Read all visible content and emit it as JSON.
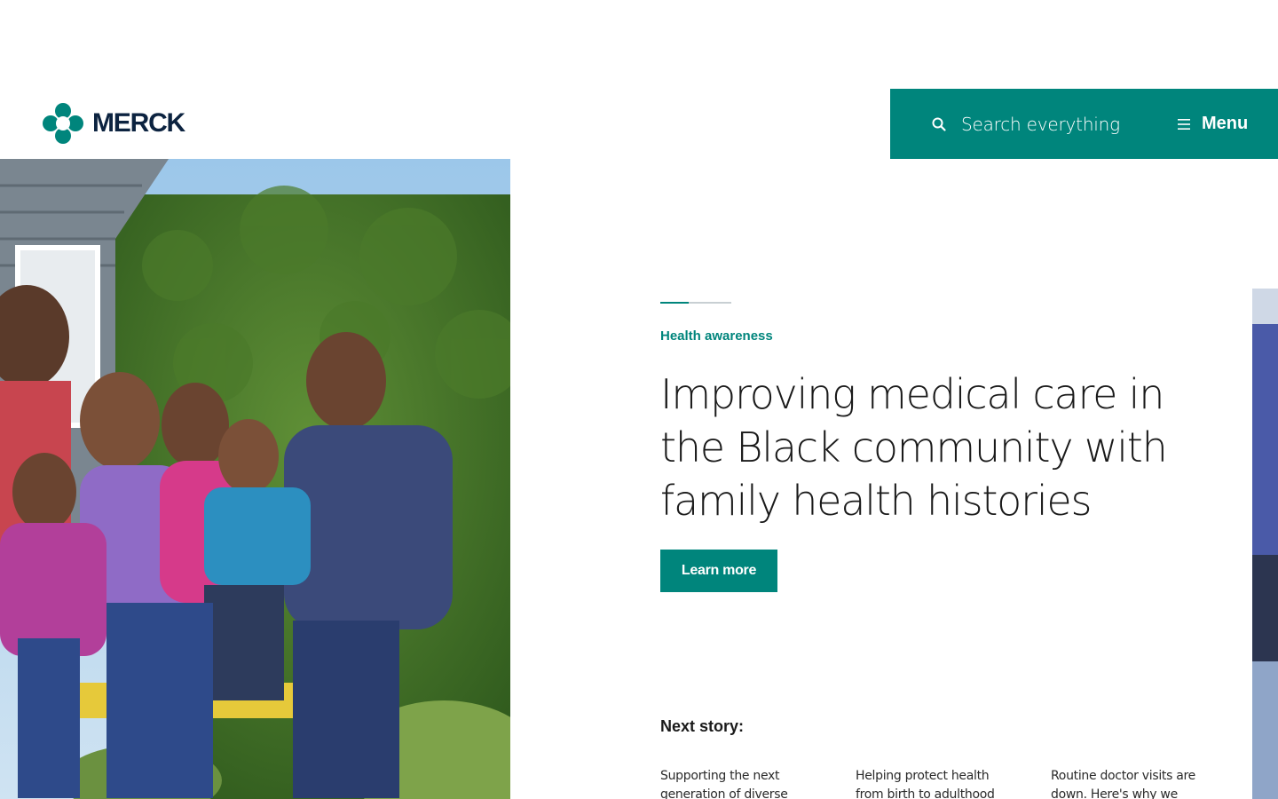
{
  "brand": {
    "name": "MERCK",
    "accent": "#00857c",
    "navy": "#0c2340"
  },
  "header": {
    "search_label": "Search everything",
    "search_icon": "search-icon",
    "menu_label": "Menu",
    "menu_icon": "hamburger-icon"
  },
  "hero": {
    "carousel_progress": 0.4,
    "eyebrow": "Health awareness",
    "headline": "Improving medical care in the Black community with family health histories",
    "cta_label": "Learn more"
  },
  "next": {
    "label": "Next story:",
    "items": [
      {
        "title": "Supporting the next generation of diverse"
      },
      {
        "title": "Helping protect health from birth to adulthood"
      },
      {
        "title": "Routine doctor visits are down. Here's why we"
      }
    ]
  }
}
